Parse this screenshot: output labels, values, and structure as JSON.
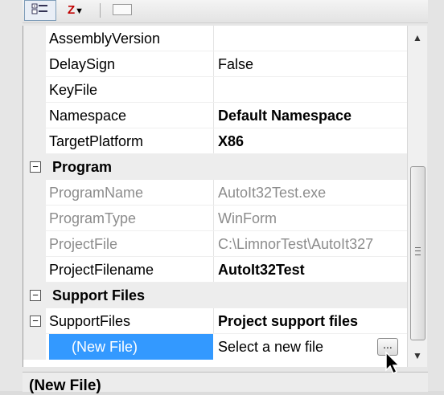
{
  "toolbar": {
    "categorized_icon": "categorized-icon",
    "alphabetical_icon": "sort-az-icon",
    "alphabetical_label": "Z",
    "property_pages_icon": "property-pages-icon"
  },
  "rows": [
    {
      "name": "AssemblyVersion",
      "value": ""
    },
    {
      "name": "DelaySign",
      "value": "False"
    },
    {
      "name": "KeyFile",
      "value": ""
    },
    {
      "name": "Namespace",
      "value": "Default Namespace"
    },
    {
      "name": "TargetPlatform",
      "value": "X86"
    }
  ],
  "program": {
    "label": "Program",
    "toggle": "⊟",
    "rows": [
      {
        "name": "ProgramName",
        "value": "AutoIt32Test.exe"
      },
      {
        "name": "ProgramType",
        "value": "WinForm"
      },
      {
        "name": "ProjectFile",
        "value": "C:\\LimnorTest\\AutoIt327"
      },
      {
        "name": "ProjectFilename",
        "value": "AutoIt32Test"
      }
    ]
  },
  "support": {
    "label": "Support Files",
    "toggle": "⊟",
    "item": {
      "name": "SupportFiles",
      "value": "Project support files",
      "toggle": "⊟"
    },
    "new_file": {
      "name": "(New File)",
      "value": "Select a new file",
      "button": "..."
    }
  },
  "scrollbar": {
    "up": "▲",
    "down": "▼",
    "grip": "≡"
  },
  "description": {
    "title": "(New File)"
  }
}
